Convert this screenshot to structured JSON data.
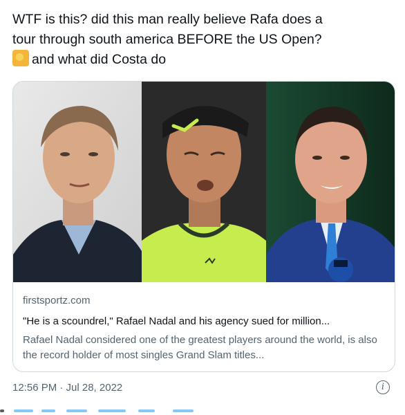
{
  "tweet": {
    "text_line1": "WTF is this? did this man really believe Rafa does a",
    "text_line2": "tour through south america BEFORE the US Open?",
    "text_line3": "and what did Costa do",
    "emoji_icon": "face-palm-emoji"
  },
  "card": {
    "domain": "firstsportz.com",
    "title": "\"He is a scoundrel,\" Rafael Nadal and his agency sued for million...",
    "description": "Rafael Nadal considered one of the greatest players around the world, is also the record holder of most singles Grand Slam titles...",
    "images": [
      "person-left-photo",
      "rafael-nadal-photo",
      "person-right-photo"
    ]
  },
  "footer": {
    "timestamp": "12:56 PM · Jul 28, 2022",
    "info_icon": "info-icon"
  },
  "colors": {
    "text": "#0f1419",
    "secondary": "#536471",
    "border": "#cfd9de",
    "link": "#1d9bf0"
  }
}
